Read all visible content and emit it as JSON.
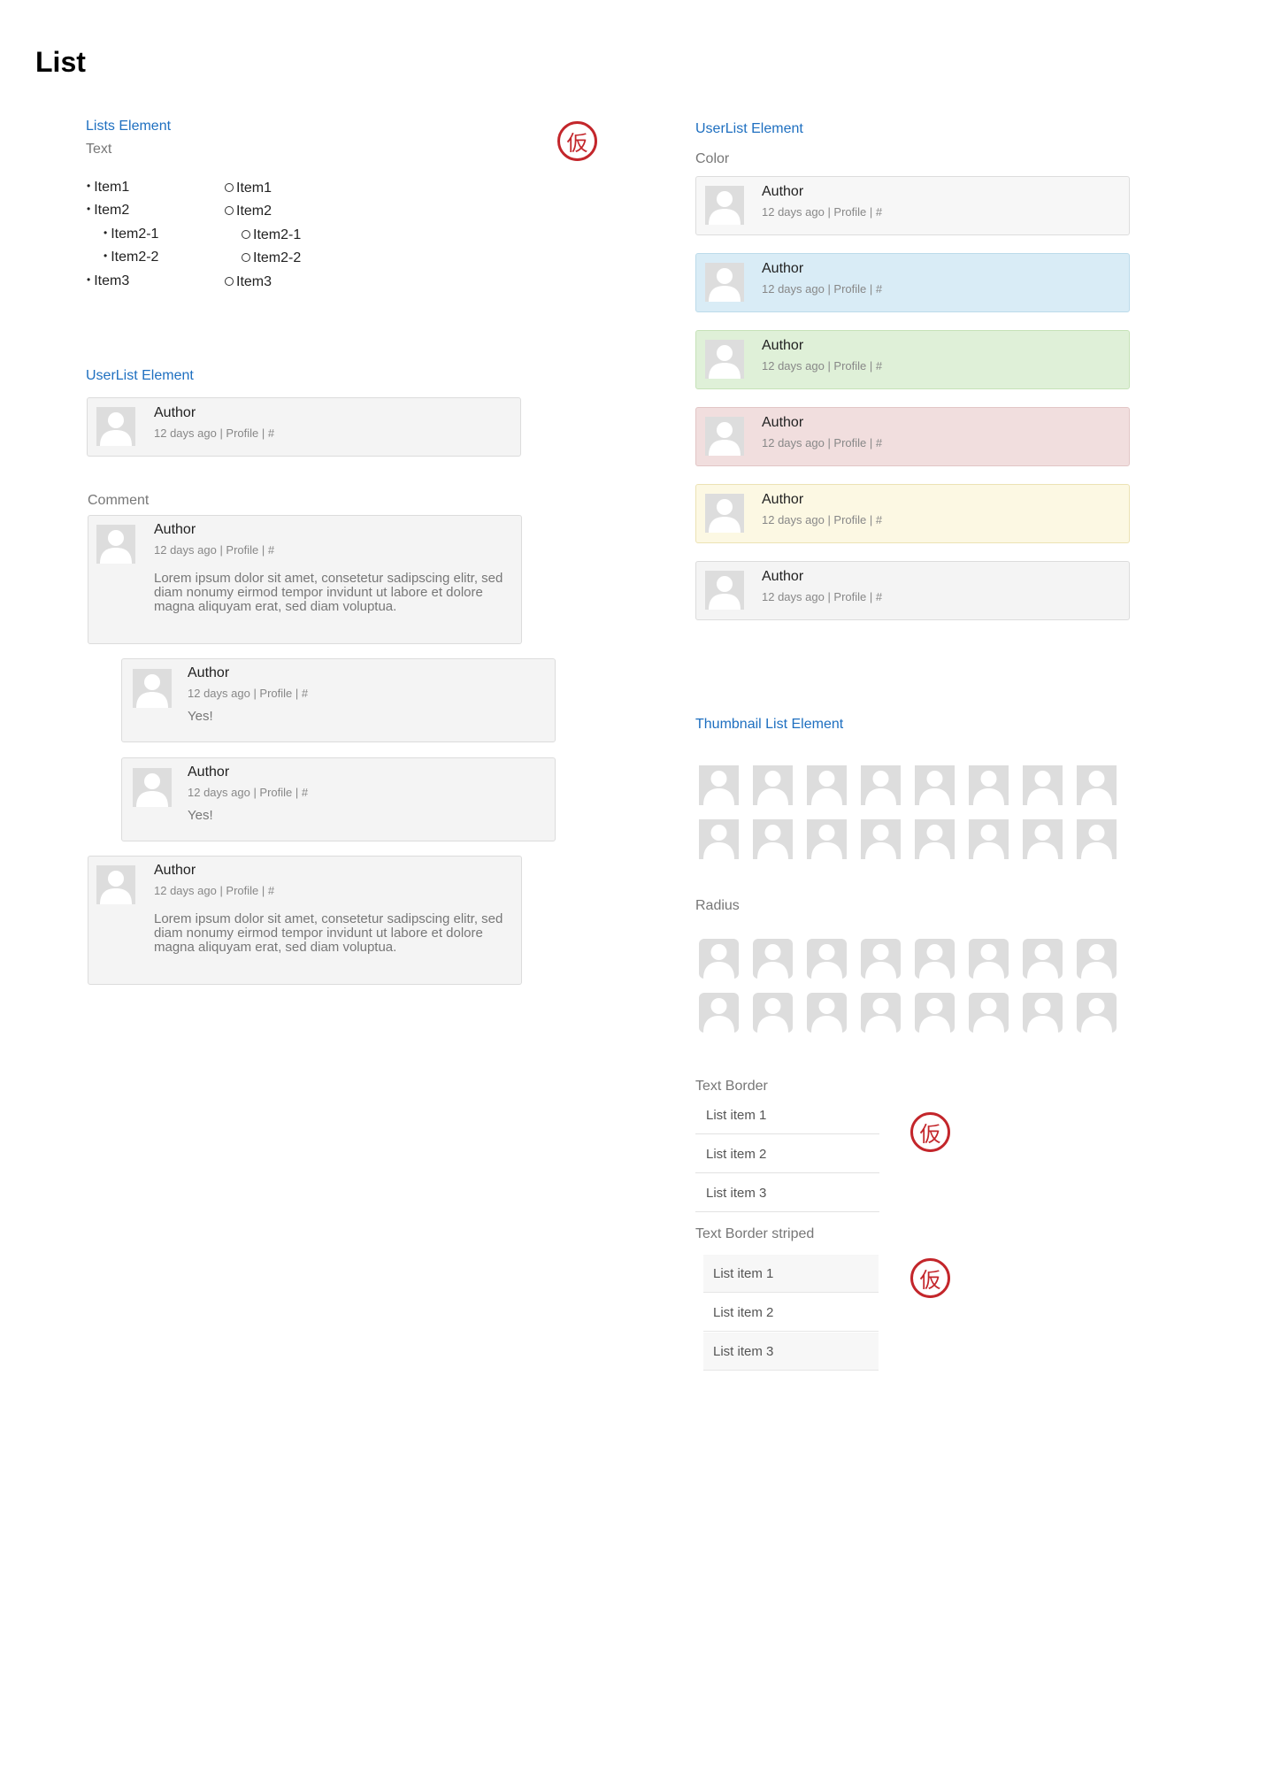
{
  "page": {
    "title": "List"
  },
  "lists_element": {
    "title": "Lists Element",
    "label": "Text",
    "bullet_items": [
      "Item1",
      "Item2",
      "Item2-1",
      "Item2-2",
      "Item3"
    ],
    "circle_items": [
      "Item1",
      "Item2",
      "Item2-1",
      "Item2-2",
      "Item3"
    ]
  },
  "stamp_text": "仮",
  "userlist_left": {
    "title": "UserList Element",
    "card": {
      "author": "Author",
      "meta": "12 days ago | Profile | #"
    }
  },
  "comment": {
    "label": "Comment",
    "items": [
      {
        "author": "Author",
        "meta": "12 days ago | Profile | #",
        "text": "Lorem ipsum dolor sit amet, consetetur sadipscing elitr, sed diam nonumy eirmod tempor invidunt ut labore et dolore magna aliquyam erat, sed diam voluptua."
      },
      {
        "author": "Author",
        "meta": "12 days ago | Profile | #",
        "text": "Yes!"
      },
      {
        "author": "Author",
        "meta": "12 days ago | Profile | #",
        "text": "Yes!"
      },
      {
        "author": "Author",
        "meta": "12 days ago | Profile | #",
        "text": "Lorem ipsum dolor sit amet, consetetur sadipscing elitr, sed diam nonumy eirmod tempor invidunt ut labore et dolore magna aliquyam erat, sed diam voluptua."
      }
    ]
  },
  "userlist_right": {
    "title": "UserList Element",
    "label": "Color",
    "cards": [
      {
        "author": "Author",
        "meta": "12 days ago | Profile | #",
        "bg": "#f7f7f7",
        "border": "#dddddd"
      },
      {
        "author": "Author",
        "meta": "12 days ago | Profile | #",
        "bg": "#d9ecf6",
        "border": "#bcdbea"
      },
      {
        "author": "Author",
        "meta": "12 days ago | Profile | #",
        "bg": "#dff0d8",
        "border": "#c6e2b8"
      },
      {
        "author": "Author",
        "meta": "12 days ago | Profile | #",
        "bg": "#f1dede",
        "border": "#e2c6c6"
      },
      {
        "author": "Author",
        "meta": "12 days ago | Profile | #",
        "bg": "#fcf8e3",
        "border": "#ece2b4"
      },
      {
        "author": "Author",
        "meta": "12 days ago | Profile | #",
        "bg": "#f4f4f4",
        "border": "#dcdcdc"
      }
    ]
  },
  "thumbnail_list": {
    "title": "Thumbnail List Element",
    "radius_label": "Radius",
    "columns": 8,
    "rows": 2
  },
  "text_border": {
    "label": "Text Border",
    "items": [
      "List item 1",
      "List item 2",
      "List item 3"
    ]
  },
  "text_border_striped": {
    "label": "Text Border striped",
    "items": [
      "List item 1",
      "List item 2",
      "List item 3"
    ]
  }
}
